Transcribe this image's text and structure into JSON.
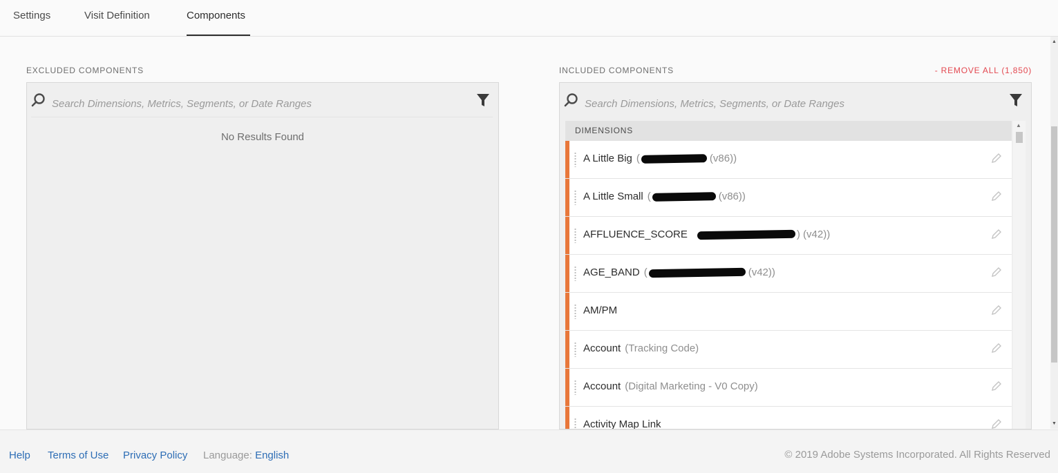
{
  "tabs": [
    {
      "label": "Settings"
    },
    {
      "label": "Visit Definition"
    },
    {
      "label": "Components",
      "active": true
    }
  ],
  "excluded": {
    "title": "EXCLUDED COMPONENTS",
    "search_placeholder": "Search Dimensions, Metrics, Segments, or Date Ranges",
    "empty_text": "No Results Found"
  },
  "included": {
    "title": "INCLUDED COMPONENTS",
    "remove_all": "- REMOVE ALL (1,850)",
    "search_placeholder": "Search Dimensions, Metrics, Segments, or Date Ranges",
    "section_header": "DIMENSIONS",
    "rows": [
      {
        "name": "A Little Big",
        "sub_prefix": "(",
        "sub_suffix": "(v86))"
      },
      {
        "name": "A Little Small",
        "sub_prefix": "(",
        "sub_suffix": "(v86))"
      },
      {
        "name": "AFFLUENCE_SCORE",
        "sub_prefix": "",
        "sub_suffix": ") (v42))"
      },
      {
        "name": "AGE_BAND",
        "sub_prefix": "(",
        "sub_suffix": "(v42))"
      },
      {
        "name": "AM/PM",
        "sub": ""
      },
      {
        "name": "Account",
        "sub": "(Tracking Code)"
      },
      {
        "name": "Account",
        "sub": "(Digital Marketing - V0 Copy)"
      },
      {
        "name": "Activity Map Link",
        "sub": ""
      }
    ]
  },
  "colors": {
    "accent_orange": "#e8773a",
    "link_blue": "#2d6db5",
    "remove_red": "#e34850"
  },
  "footer": {
    "help": "Help",
    "terms": "Terms of Use",
    "privacy": "Privacy Policy",
    "language_label": "Language:",
    "language_value": "English",
    "copyright": "© 2019 Adobe Systems Incorporated. All Rights Reserved"
  }
}
